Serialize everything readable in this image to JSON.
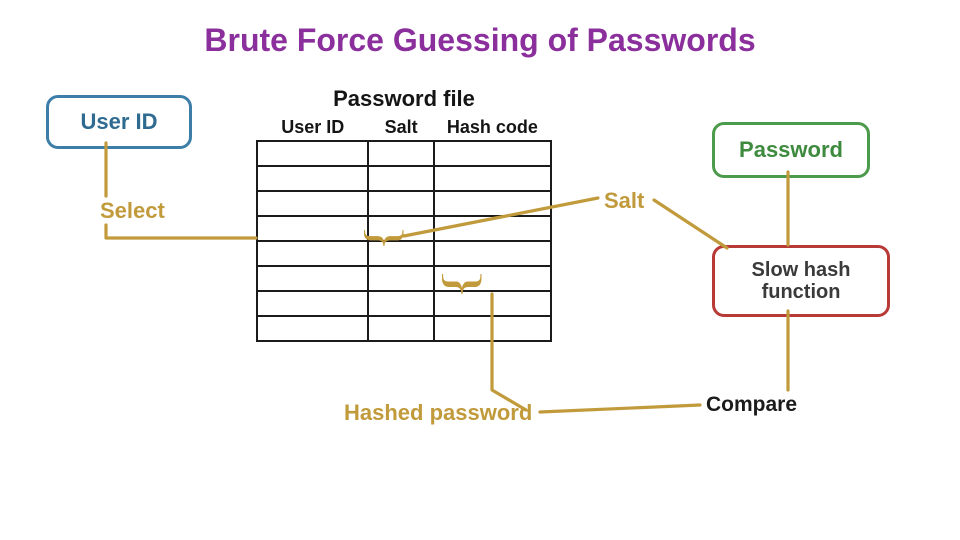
{
  "title": "Brute Force Guessing of Passwords",
  "boxes": {
    "user_id": "User ID",
    "password": "Password",
    "slow_hash_line1": "Slow hash",
    "slow_hash_line2": "function"
  },
  "labels": {
    "select": "Select",
    "salt": "Salt",
    "hashed_password": "Hashed password",
    "compare": "Compare"
  },
  "password_file": {
    "caption": "Password file",
    "columns": [
      "User ID",
      "Salt",
      "Hash code"
    ]
  }
}
